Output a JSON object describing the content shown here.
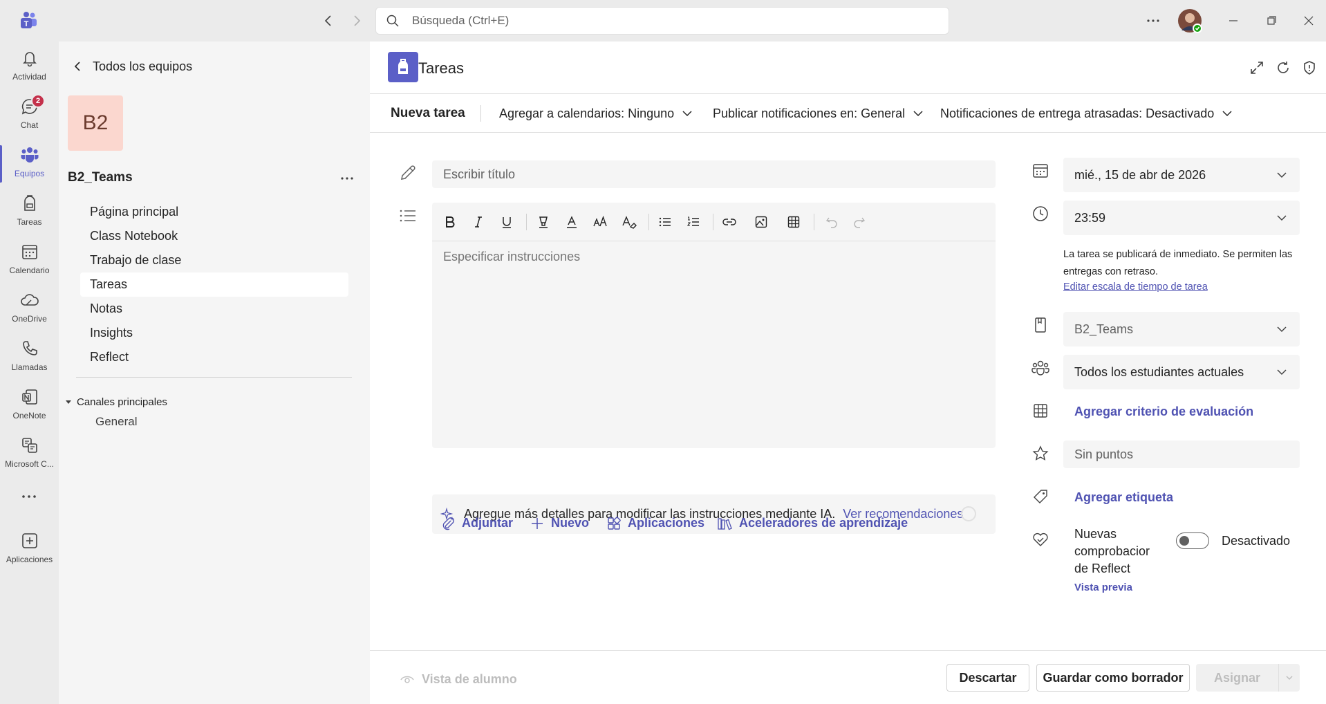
{
  "topbar": {
    "search_placeholder": "Búsqueda (Ctrl+E)"
  },
  "rail": {
    "items": [
      {
        "label": "Actividad",
        "icon": "bell-icon"
      },
      {
        "label": "Chat",
        "icon": "chat-icon",
        "badge": "2"
      },
      {
        "label": "Equipos",
        "icon": "teams-icon"
      },
      {
        "label": "Tareas",
        "icon": "backpack-icon"
      },
      {
        "label": "Calendario",
        "icon": "calendar-icon"
      },
      {
        "label": "OneDrive",
        "icon": "cloud-icon"
      },
      {
        "label": "Llamadas",
        "icon": "phone-icon"
      },
      {
        "label": "OneNote",
        "icon": "onenote-icon"
      },
      {
        "label": "Microsoft C...",
        "icon": "copilot-icon"
      },
      {
        "label": "Aplicaciones",
        "icon": "add-apps-icon"
      }
    ]
  },
  "team": {
    "back_label": "Todos los equipos",
    "avatar_text": "B2",
    "name": "B2_Teams",
    "nav": [
      "Página principal",
      "Class Notebook",
      "Trabajo de clase",
      "Tareas",
      "Notas",
      "Insights",
      "Reflect"
    ],
    "channels_header": "Canales principales",
    "channels": [
      "General"
    ]
  },
  "app": {
    "title": "Tareas"
  },
  "toolbar": {
    "new_task": "Nueva tarea",
    "calendars": "Agregar a calendarios: Ninguno",
    "notifications": "Publicar notificaciones en: General",
    "late": "Notificaciones de entrega atrasadas: Desactivado"
  },
  "form": {
    "title_placeholder": "Escribir título",
    "instructions_placeholder": "Especificar instrucciones",
    "ai_text": "Agregue más detalles para modificar las instrucciones mediante IA.",
    "ai_link": "Ver recomendaciones",
    "attach": "Adjuntar",
    "new": "Nuevo",
    "apps": "Aplicaciones",
    "accelerators": "Aceleradores de aprendizaje"
  },
  "side": {
    "date": "mié., 15 de abr de 2026",
    "time": "23:59",
    "schedule_note": "La tarea se publicará de inmediato. Se permiten las entregas con retraso.",
    "schedule_link": "Editar escala de tiempo de tarea",
    "class": "B2_Teams",
    "students": "Todos los estudiantes actuales",
    "rubric": "Agregar criterio de evaluación",
    "points_placeholder": "Sin puntos",
    "tag": "Agregar etiqueta",
    "reflect_label": "Nuevas comprobacior de Reflect",
    "reflect_state": "Desactivado",
    "preview": "Vista previa"
  },
  "footer": {
    "student_view": "Vista de alumno",
    "discard": "Descartar",
    "save_draft": "Guardar como borrador",
    "assign": "Asignar"
  },
  "colors": {
    "accent": "#5b5fc7",
    "link": "#4f52b2",
    "badge": "#c4314b",
    "avatar_bg": "#fbd7cf"
  }
}
